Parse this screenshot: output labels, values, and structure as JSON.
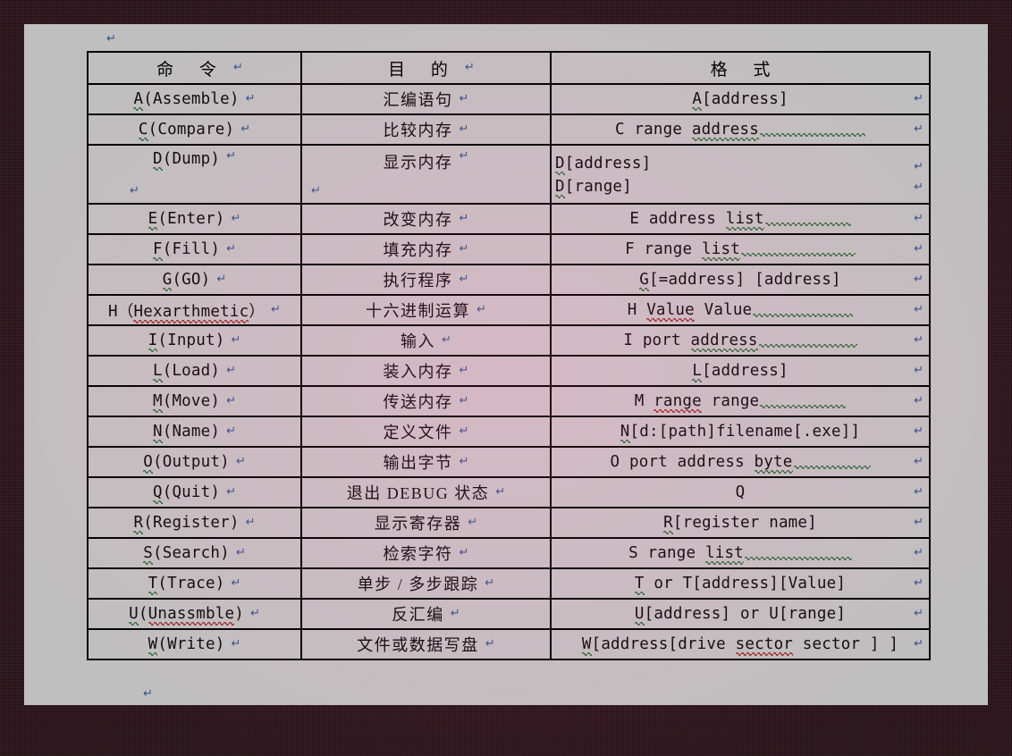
{
  "document": {
    "kind": "word-document-screenshot",
    "frame_color": "#2c0c16",
    "page_color": "#ffffff",
    "grammar_underline_color": "#1f7a34",
    "spelling_underline_color": "#c01a1a",
    "paragraph_mark_color": "#4a6fb5",
    "paragraph_mark_glyph": "↵"
  },
  "table": {
    "headers": [
      "命    令",
      "目    的",
      "格    式"
    ],
    "rows": [
      {
        "command": "A(Assemble)",
        "purpose": "汇编语句",
        "format": "A[address]",
        "cmd_green": "A",
        "fmt_green": "A",
        "fmt_tail": 0
      },
      {
        "command": "C(Compare)",
        "purpose": "比较内存",
        "format": "C range address",
        "cmd_green": "C",
        "fmt_green": "address",
        "fmt_tail": 118
      },
      {
        "command": "D(Dump)",
        "purpose": "显示内存",
        "format": "D[address]",
        "format2": "D[range]",
        "cmd_green": "D",
        "fmt_green": "D",
        "fmt2_green": "D",
        "tall": true,
        "fmt_tail": 0
      },
      {
        "command": "E(Enter)",
        "purpose": "改变内存",
        "format": "E address list",
        "cmd_green": "E",
        "fmt_green": "list",
        "fmt_tail": 96
      },
      {
        "command": "F(Fill)",
        "purpose": "填充内存",
        "format": "F range list",
        "cmd_green": "F",
        "fmt_green": "list",
        "fmt_tail": 128
      },
      {
        "command": "G(GO)",
        "purpose": "执行程序",
        "format": "G[=address] [address]",
        "cmd_green": "G",
        "fmt_green": "G",
        "fmt_tail": 0
      },
      {
        "command": "H（Hexarthmetic）",
        "purpose": "十六进制运算",
        "format": "H Value Value",
        "cmd_red": "Hexarthmetic",
        "fmt_red": "Value",
        "fmt_tail": 112
      },
      {
        "command": "I(Input)",
        "purpose": "输入",
        "format": "I port address",
        "cmd_green": "I",
        "fmt_green": "address",
        "fmt_tail": 110
      },
      {
        "command": "L(Load)",
        "purpose": "装入内存",
        "format": "L[address]",
        "cmd_green": "L",
        "fmt_green": "L",
        "fmt_tail": 0
      },
      {
        "command": "M(Move)",
        "purpose": "传送内存",
        "format": "M range range",
        "cmd_green": "M",
        "fmt_red": "range",
        "fmt_tail": 96
      },
      {
        "command": "N(Name)",
        "purpose": "定义文件",
        "format": "N[d:[path]filename[.exe]]",
        "cmd_green": "N",
        "fmt_green": "N",
        "fmt_tail": 0
      },
      {
        "command": "O(Output)",
        "purpose": "输出字节",
        "format": "O port address byte",
        "cmd_green": "O",
        "fmt_green": "byte",
        "fmt_tail": 86
      },
      {
        "command": "Q(Quit)",
        "purpose": "退出 DEBUG 状态",
        "format": "Q",
        "cmd_green": "Q",
        "fmt_tail": 0
      },
      {
        "command": "R(Register)",
        "purpose": "显示寄存器",
        "format": "R[register name]",
        "cmd_green": "R",
        "fmt_green": "R",
        "fmt_tail": 0
      },
      {
        "command": "S(Search)",
        "purpose": "检索字符",
        "format": "S range list",
        "cmd_green": "S",
        "fmt_green": "list",
        "fmt_tail": 120
      },
      {
        "command": "T(Trace)",
        "purpose": "单步 / 多步跟踪",
        "format": "T or T[address][Value]",
        "cmd_green": "T",
        "fmt_green": "T",
        "fmt_tail": 0
      },
      {
        "command": "U(Unassmble)",
        "purpose": "反汇编",
        "format": "U[address] or U[range]",
        "cmd_green": "U",
        "cmd_red": "Unassmble",
        "fmt_green": "U",
        "fmt_tail": 0
      },
      {
        "command": "W(Write)",
        "purpose": "文件或数据写盘",
        "format": "W[address[drive sector sector ] ]",
        "cmd_green": "W",
        "fmt_green": "W",
        "fmt_red": "sector",
        "fmt_tail": 0
      }
    ]
  }
}
